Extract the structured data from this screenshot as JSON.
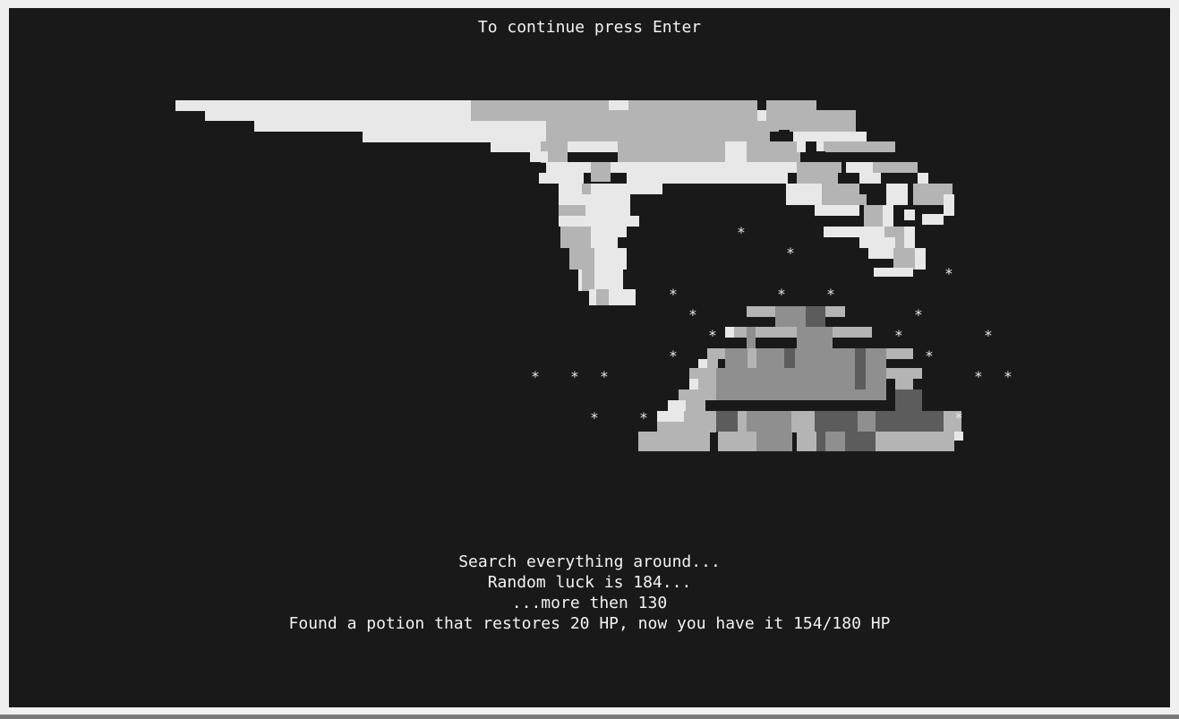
{
  "console": {
    "prompt": "To continue press Enter",
    "messages": [
      "Search everything around...",
      "Random luck is 184...",
      "...more then 130",
      "Found a potion that restores 20 HP, now you have it 154/180 HP"
    ]
  },
  "player": {
    "hp_current": 154,
    "hp_max": 180,
    "luck": 184,
    "luck_threshold": 130,
    "potion_restore": 20
  },
  "scene": {
    "art_subjects": [
      "hand-art",
      "rock-art",
      "sparkle-stars"
    ],
    "sparkle_glyph": "*",
    "palette": {
      "background": "#191919",
      "light": "#e8e8e8",
      "mid": "#b4b4b4",
      "dark": "#8f8f8f",
      "shade": "#5c5c5c",
      "text": "#f2f2f2"
    }
  }
}
